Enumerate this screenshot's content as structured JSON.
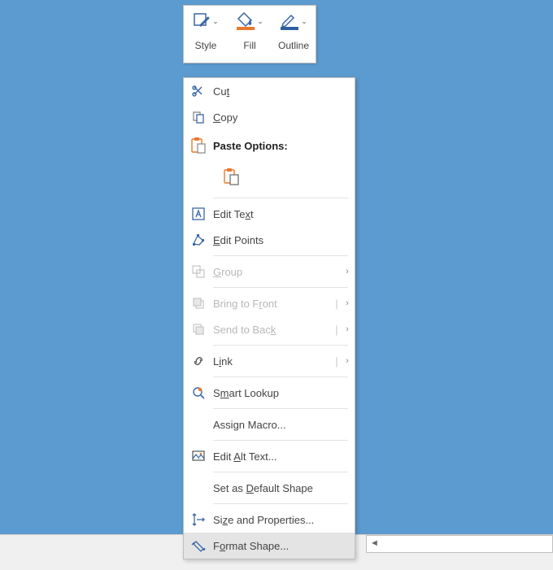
{
  "toolbar": {
    "style_label": "Style",
    "fill_label": "Fill",
    "outline_label": "Outline"
  },
  "menu": {
    "cut": "Cut",
    "copy": "Copy",
    "paste_options": "Paste Options:",
    "edit_text": "Edit Text",
    "edit_points": "Edit Points",
    "group": "Group",
    "bring_to_front": "Bring to Front",
    "send_to_back": "Send to Back",
    "link": "Link",
    "smart_lookup": "Smart Lookup",
    "assign_macro": "Assign Macro...",
    "edit_alt_text": "Edit Alt Text...",
    "set_default": "Set as Default Shape",
    "size_properties": "Size and Properties...",
    "format_shape": "Format Shape..."
  }
}
